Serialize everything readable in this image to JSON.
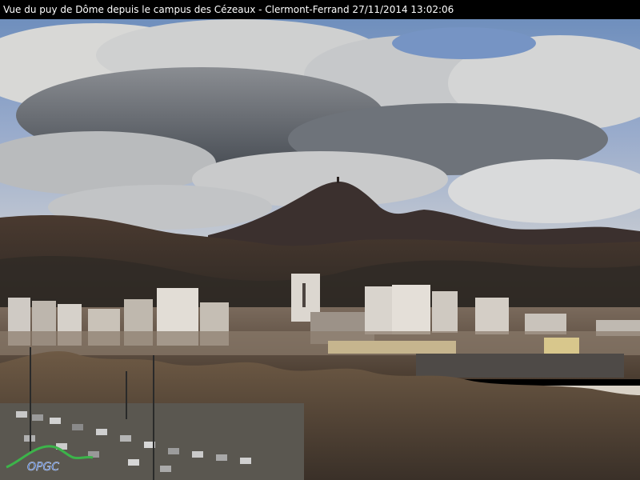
{
  "webcam": {
    "caption": "Vue du puy de Dôme depuis le campus des Cézeaux - Clermont-Ferrand 27/11/2014 13:02:06",
    "watermark": "OPGC"
  },
  "colors": {
    "caption_bg": "#000000",
    "caption_text": "#ffffff",
    "sky_blue": "#5f83b8",
    "cloud_light": "#d9d9d6",
    "cloud_dark": "#5a5f66",
    "mountain": "#3a2e2c",
    "logo_green": "#3cb44a",
    "logo_blue": "#2e5fb8"
  }
}
